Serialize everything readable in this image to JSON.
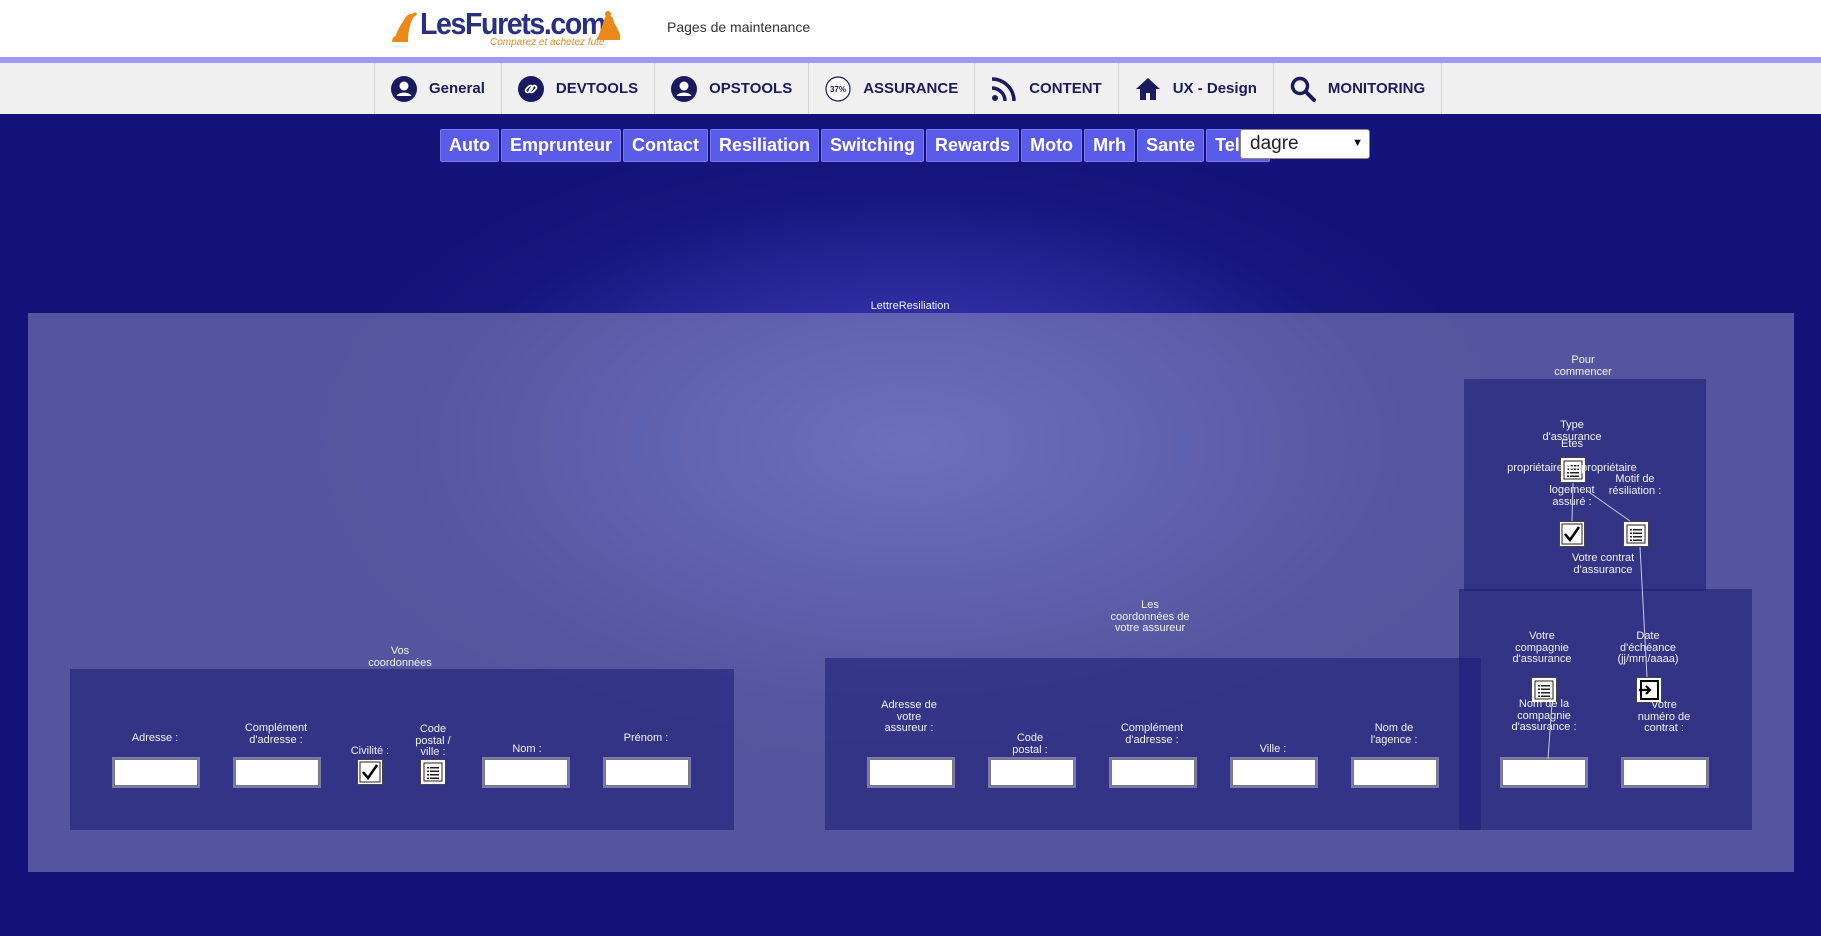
{
  "header": {
    "logo_text": "LesFurets.com",
    "logo_tagline": "Comparez et achetez futé",
    "subtitle": "Pages de maintenance"
  },
  "nav": [
    {
      "label": "General",
      "icon": "user-icon"
    },
    {
      "label": "DEVTOOLS",
      "icon": "link-icon"
    },
    {
      "label": "OPSTOOLS",
      "icon": "user-icon"
    },
    {
      "label": "ASSURANCE",
      "icon": "percent-badge-icon",
      "badge": "37%"
    },
    {
      "label": "CONTENT",
      "icon": "rss-icon"
    },
    {
      "label": "UX - Design",
      "icon": "home-icon"
    },
    {
      "label": "MONITORING",
      "icon": "search-icon"
    }
  ],
  "submenu": [
    "Auto",
    "Emprunteur",
    "Contact",
    "Resiliation",
    "Switching",
    "Rewards",
    "Moto",
    "Mrh",
    "Sante",
    "Telco"
  ],
  "select": {
    "value": "dagre"
  },
  "diagram": {
    "root": "LettreResiliation",
    "groups": {
      "vos_coordonnees": "Vos coordonnées",
      "coord_assureur": "Les coordonnées de votre assureur",
      "pour_commencer": "Pour commencer",
      "votre_contrat": "Votre contrat d'assurance"
    },
    "fields": {
      "adresse": "Adresse :",
      "complement": "Complément d'adresse :",
      "civilite": "Civilité :",
      "code_postal_ville": "Code postal / ville :",
      "nom": "Nom :",
      "prenom": "Prénom :",
      "adresse_assureur": "Adresse de votre assureur :",
      "code_postal": "Code postal :",
      "complement2": "Complément d'adresse :",
      "ville": "Ville :",
      "nom_agence": "Nom de l'agence :",
      "type_assurance": "Type d'assurance",
      "etes": "Etes",
      "proprietaire": "propriétaire ou propriétaire",
      "logement": "logement assuré :",
      "motif": "Motif de résiliation :",
      "votre_compagnie": "Votre compagnie d'assurance",
      "date_echeance": "Date d'échéance (jj/mm/aaaa)",
      "nom_compagnie": "Nom de la compagnie d'assurance :",
      "numero_contrat": "Votre numéro de contrat :"
    }
  },
  "colors": {
    "background": "#13137a",
    "accent": "#5b5bea",
    "nav_text": "#1a1a5e",
    "logo_orange": "#e98a1a"
  }
}
